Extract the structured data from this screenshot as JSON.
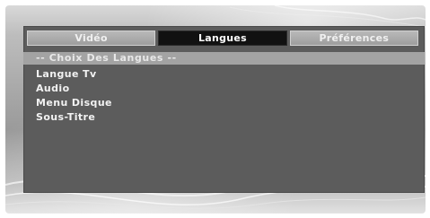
{
  "tabs": [
    {
      "label": "Vidéo"
    },
    {
      "label": "Langues"
    },
    {
      "label": "Préférences"
    }
  ],
  "active_tab": "Langues",
  "section": {
    "header": "-- Choix Des Langues --",
    "items": [
      {
        "label": "Langue Tv"
      },
      {
        "label": "Audio"
      },
      {
        "label": "Menu Disque"
      },
      {
        "label": "Sous-Titre"
      }
    ]
  },
  "colors": {
    "panel": "#5c5c5c",
    "active_tab": "#111111",
    "header_bar": "#a3a3a3",
    "text": "#f2f2f2"
  }
}
